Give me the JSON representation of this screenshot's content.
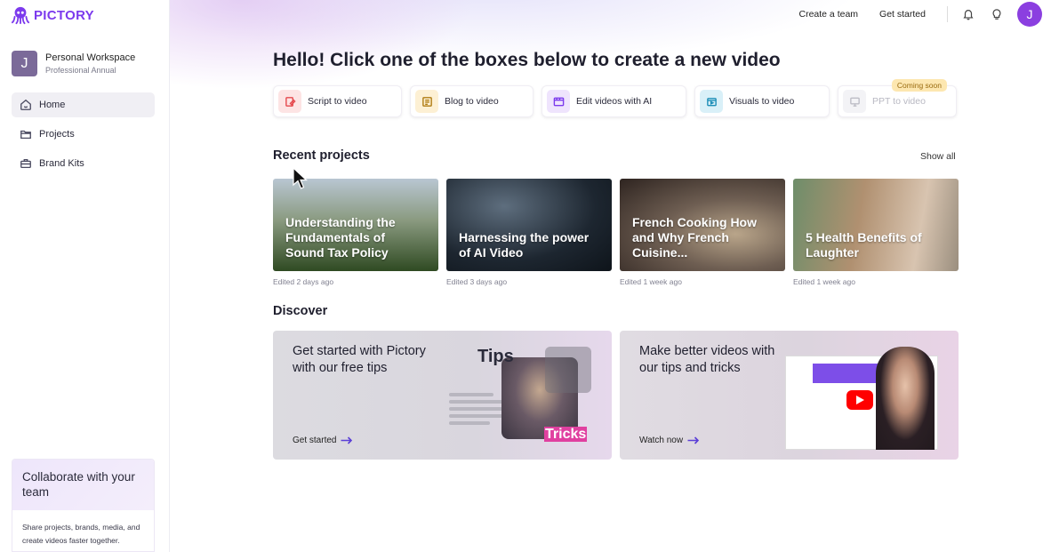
{
  "brand": {
    "name": "PICTORY",
    "accent": "#7c3aed"
  },
  "workspace": {
    "initial": "J",
    "name": "Personal Workspace",
    "plan": "Professional Annual"
  },
  "sidebar": {
    "items": [
      {
        "label": "Home",
        "icon": "home-icon",
        "active": true
      },
      {
        "label": "Projects",
        "icon": "folder-icon",
        "active": false
      },
      {
        "label": "Brand Kits",
        "icon": "briefcase-icon",
        "active": false
      }
    ],
    "collab": {
      "title": "Collaborate with your team",
      "text": "Share projects, brands, media, and create videos faster together."
    }
  },
  "topbar": {
    "create_team": "Create a team",
    "get_started": "Get started",
    "user_initial": "J"
  },
  "headline": "Hello! Click one of the boxes below to create a new video",
  "create_options": [
    {
      "label": "Script to video",
      "icon": "script-icon",
      "color": "#e5484d",
      "bg": "#fde4e4"
    },
    {
      "label": "Blog to video",
      "icon": "blog-icon",
      "color": "#b07c12",
      "bg": "#fdf0d4"
    },
    {
      "label": "Edit videos with AI",
      "icon": "edit-video-icon",
      "color": "#7c3aed",
      "bg": "#efe4fd"
    },
    {
      "label": "Visuals to video",
      "icon": "visuals-icon",
      "color": "#1f8fb8",
      "bg": "#d9f0f8"
    },
    {
      "label": "PPT to video",
      "icon": "ppt-icon",
      "color": "#bdbdc6",
      "bg": "#f3f3f6",
      "badge": "Coming soon"
    }
  ],
  "recent": {
    "title": "Recent projects",
    "show_all": "Show all",
    "projects": [
      {
        "title": "Understanding the Fundamentals of Sound Tax Policy",
        "edited": "Edited 2 days ago"
      },
      {
        "title": "Harnessing the power of AI Video",
        "edited": "Edited 3 days ago"
      },
      {
        "title": "French Cooking How and Why French Cuisine...",
        "edited": "Edited 1 week ago"
      },
      {
        "title": "5 Health Benefits of Laughter",
        "edited": "Edited 1 week ago"
      }
    ]
  },
  "discover": {
    "title": "Discover",
    "cards": [
      {
        "title": "Get started with Pictory with our free tips",
        "link": "Get started",
        "art_top": "Tips",
        "art_bottom": "Tricks"
      },
      {
        "title": "Make better videos with our tips and tricks",
        "link": "Watch now"
      }
    ]
  }
}
